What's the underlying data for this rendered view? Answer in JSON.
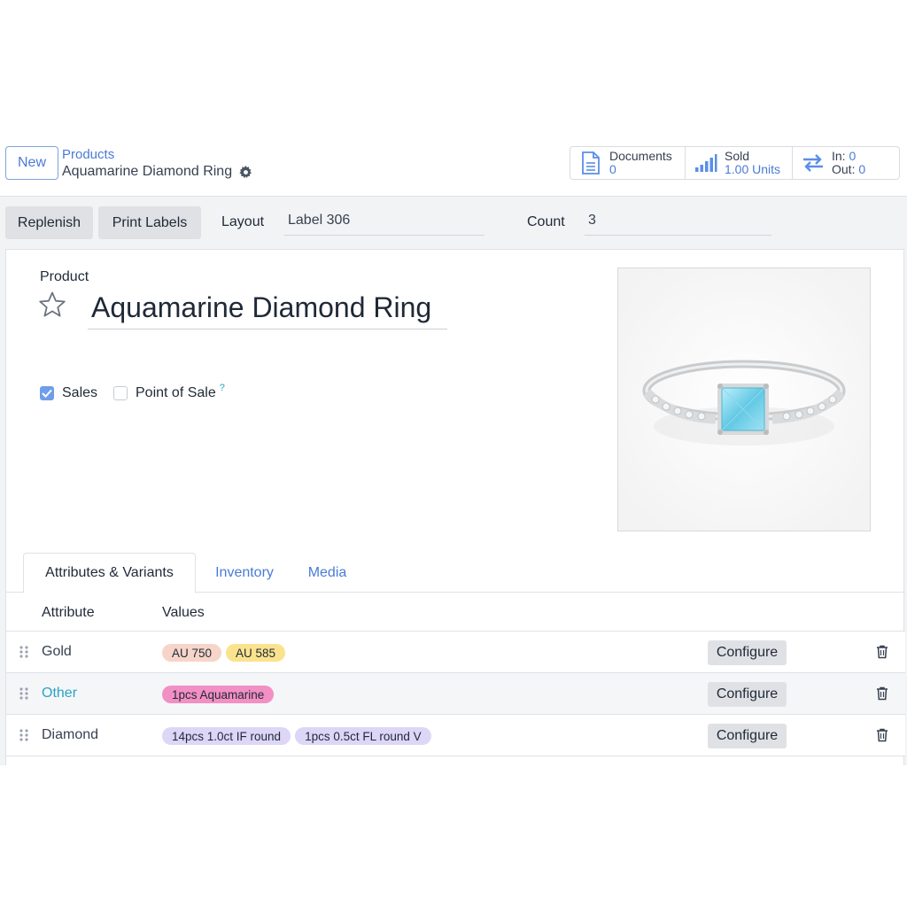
{
  "control_panel": {
    "new_label": "New",
    "breadcrumb_parent": "Products",
    "breadcrumb_current": "Aquamarine Diamond Ring",
    "stats": {
      "documents_label": "Documents",
      "documents_value": "0",
      "sold_label": "Sold",
      "sold_value": "1.00 Units",
      "in_label": "In:",
      "in_value": "0",
      "out_label": "Out:",
      "out_value": "0"
    }
  },
  "toolbar": {
    "replenish_label": "Replenish",
    "print_labels_label": "Print Labels",
    "layout_label": "Layout",
    "layout_value": "Label 306",
    "count_label": "Count",
    "count_value": "3"
  },
  "form": {
    "product_label": "Product",
    "product_name": "Aquamarine Diamond Ring",
    "sales_label": "Sales",
    "sales_checked": true,
    "pos_label": "Point of Sale",
    "pos_checked": false,
    "help_mark": "?"
  },
  "tabs": [
    {
      "label": "Attributes & Variants",
      "active": true
    },
    {
      "label": "Inventory",
      "active": false
    },
    {
      "label": "Media",
      "active": false
    }
  ],
  "table": {
    "headers": {
      "attribute": "Attribute",
      "values": "Values"
    },
    "configure_label": "Configure",
    "rows": [
      {
        "attribute": "Gold",
        "values": [
          {
            "label": "AU 750",
            "color": "#f6d5c8"
          },
          {
            "label": "AU 585",
            "color": "#fbe38e"
          }
        ]
      },
      {
        "attribute": "Other",
        "values": [
          {
            "label": "1pcs Aquamarine",
            "color": "#f28fc4"
          }
        ]
      },
      {
        "attribute": "Diamond",
        "values": [
          {
            "label": "14pcs 1.0ct IF round",
            "color": "#ddd6f7"
          },
          {
            "label": "1pcs 0.5ct FL round V",
            "color": "#ddd6f7"
          }
        ]
      }
    ]
  },
  "colors": {
    "accent": "#4a7bd6",
    "link_teal": "#2aa3c4",
    "gray_button": "#dfe1e5"
  }
}
